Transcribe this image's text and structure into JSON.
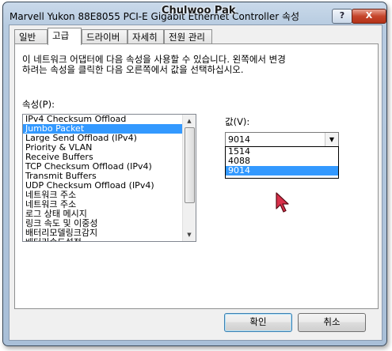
{
  "window": {
    "title": "Marvell Yukon 88E8055 PCI-E Gigabit Ethernet Controller 속성",
    "watermark": "Chulwoo Pak",
    "help_label": "?",
    "close_label": "X"
  },
  "tabs": [
    {
      "label": "일반",
      "active": false
    },
    {
      "label": "고급",
      "active": true
    },
    {
      "label": "드라이버",
      "active": false
    },
    {
      "label": "자세히",
      "active": false
    },
    {
      "label": "전원 관리",
      "active": false
    }
  ],
  "description": {
    "line1": "이 네트워크 어댑터에 다음 속성을 사용할 수 있습니다. 왼쪽에서 변경",
    "line2": "하려는 속성을 클릭한 다음 오른쪽에서 값을 선택하십시오."
  },
  "property": {
    "label": "속성(P):",
    "items": [
      "IPv4 Checksum Offload",
      "Jumbo Packet",
      "Large Send Offload (IPv4)",
      "Priority & VLAN",
      "Receive Buffers",
      "TCP Checksum Offload (IPv4)",
      "Transmit Buffers",
      "UDP Checksum Offload (IPv4)",
      "네트워크 주소",
      "네트워크 주소",
      "로그 상태 메시지",
      "링크 속도 및 이중성",
      "배터리모델링크감지",
      "배터리속도설정"
    ],
    "selected_index": 1
  },
  "value": {
    "label": "값(V):",
    "current": "9014",
    "options": [
      "1514",
      "4088",
      "9014"
    ],
    "highlighted_index": 2
  },
  "buttons": {
    "ok": "확인",
    "cancel": "취소"
  }
}
